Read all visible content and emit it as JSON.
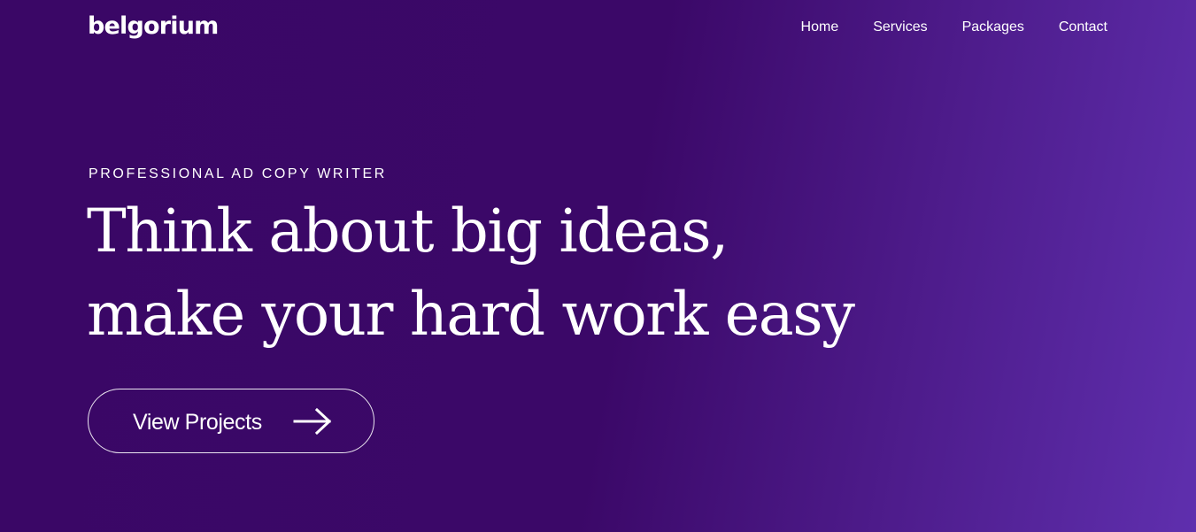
{
  "brand": {
    "name": "belgorium"
  },
  "nav": {
    "items": [
      "Home",
      "Services",
      "Packages",
      "Contact"
    ]
  },
  "hero": {
    "eyebrow": "PROFESSIONAL AD COPY WRITER",
    "headline_line1": "Think about big ideas,",
    "headline_line2": "make your hard work easy",
    "cta_label": "View Projects",
    "cta_icon": "arrow-right-icon"
  },
  "colors": {
    "background_start": "#3a0766",
    "background_end": "#5f2fae",
    "text": "#ffffff"
  }
}
